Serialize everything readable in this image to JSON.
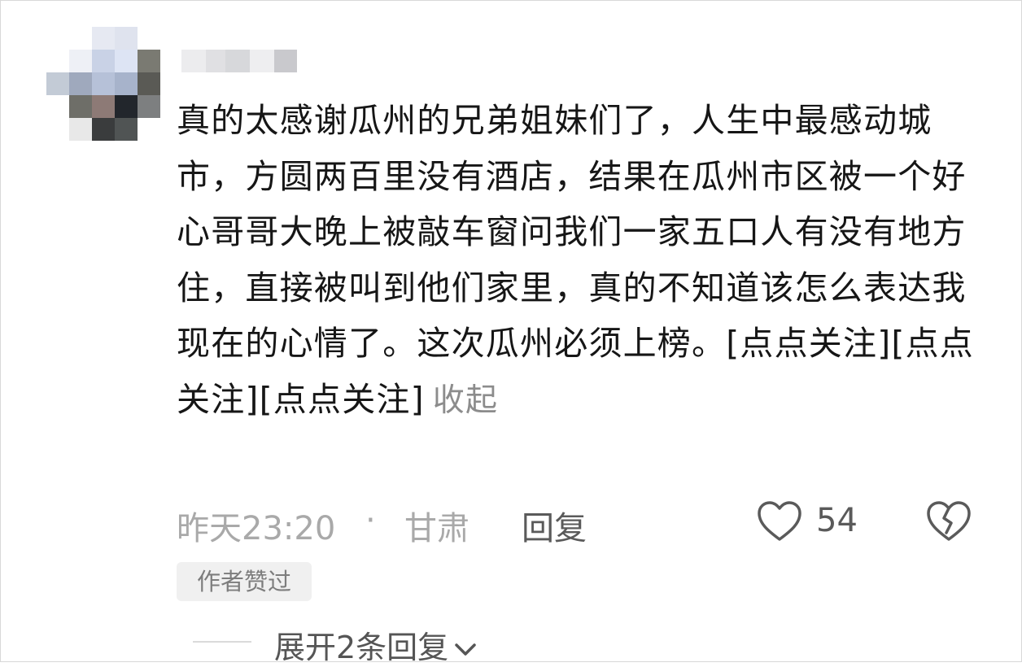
{
  "comment": {
    "text": "真的太感谢瓜州的兄弟姐妹们了，人生中最感动城市，方圆两百里没有酒店，结果在瓜州市区被一个好心哥哥大晚上被敲车窗问我们一家五口人有没有地方住，直接被叫到他们家里，真的不知道该怎么表达我现在的心情了。这次瓜州必须上榜。[点点关注][点点关注][点点关注]",
    "collapse_label": "收起"
  },
  "meta": {
    "time": "昨天23:20",
    "separator": "·",
    "location": "甘肃",
    "reply_label": "回复",
    "like_count": "54"
  },
  "badge": {
    "label": "作者赞过"
  },
  "replies": {
    "expand_label": "展开2条回复"
  },
  "icons": {
    "like": "heart-outline-icon",
    "dislike": "broken-heart-icon",
    "expand": "chevron-down-icon"
  },
  "colors": {
    "text": "#161616",
    "muted": "#a9a9a9",
    "secondary": "#5a5a5a",
    "badge_bg": "#f0f0f0"
  }
}
